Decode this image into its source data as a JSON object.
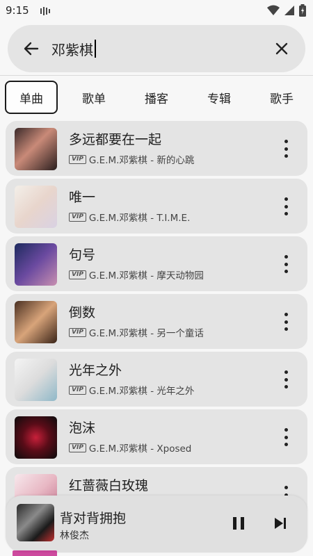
{
  "status": {
    "time": "9:15"
  },
  "search": {
    "query": "邓紫棋"
  },
  "tabs": [
    {
      "label": "单曲",
      "active": true
    },
    {
      "label": "歌单"
    },
    {
      "label": "播客"
    },
    {
      "label": "专辑"
    },
    {
      "label": "歌手"
    }
  ],
  "badge": "VIP",
  "songs": [
    {
      "title": "多远都要在一起",
      "subtitle": "G.E.M.邓紫棋 - 新的心跳"
    },
    {
      "title": "唯一",
      "subtitle": "G.E.M.邓紫棋 - T.I.M.E."
    },
    {
      "title": "句号",
      "subtitle": "G.E.M.邓紫棋 - 摩天动物园"
    },
    {
      "title": "倒数",
      "subtitle": "G.E.M.邓紫棋 - 另一个童话"
    },
    {
      "title": "光年之外",
      "subtitle": "G.E.M.邓紫棋 - 光年之外"
    },
    {
      "title": "泡沫",
      "subtitle": "G.E.M.邓紫棋 - Xposed"
    },
    {
      "title": "红蔷薇白玫瑰",
      "subtitle": ""
    }
  ],
  "player": {
    "title": "背对背拥抱",
    "artist": "林俊杰"
  },
  "colors": {
    "card": "#e4e4e4",
    "background": "#f7f7f7",
    "text": "#1f1f1f"
  }
}
